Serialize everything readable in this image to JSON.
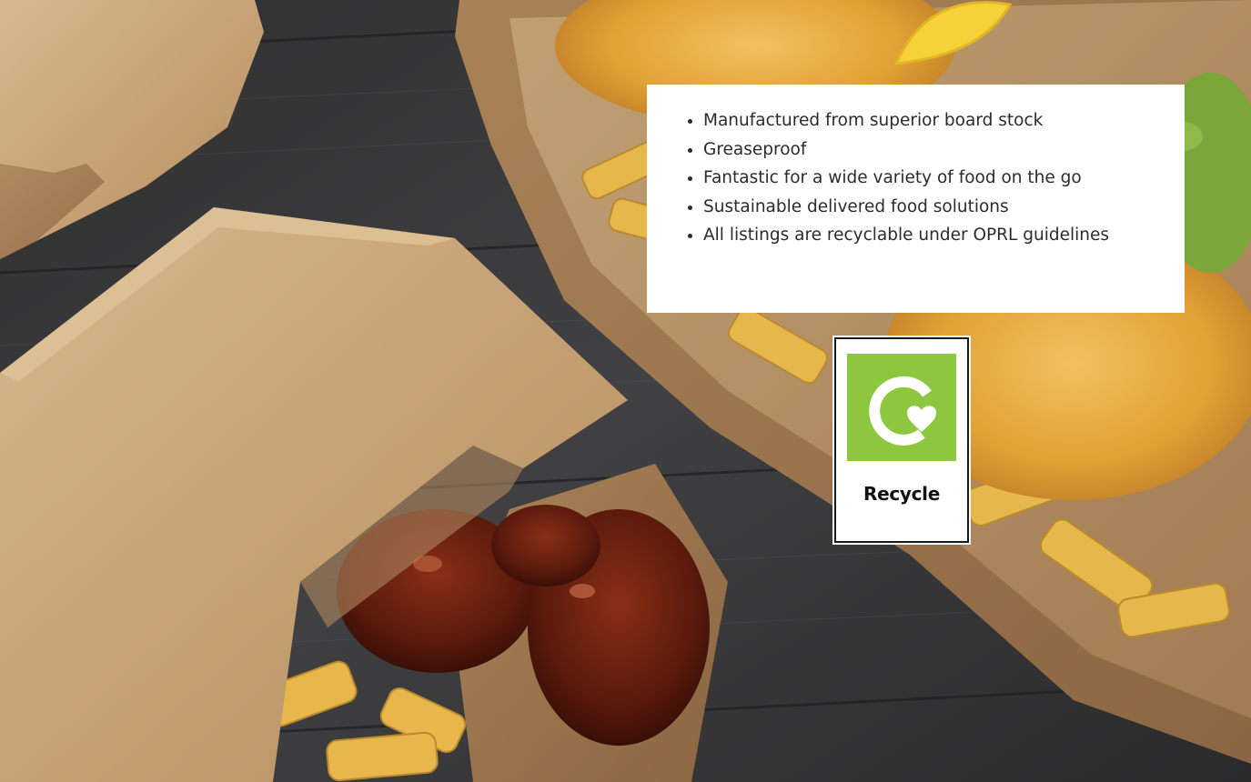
{
  "features": {
    "items": [
      "Manufactured from superior board stock",
      "Greaseproof",
      "Fantastic for a wide variety of food on the go",
      "Sustainable delivered food solutions",
      "All listings are recyclable under OPRL guidelines"
    ]
  },
  "recycle_badge": {
    "label": "Recycle",
    "icon": "recycle-icon",
    "accent": "#8dc63f"
  },
  "colors": {
    "table_wood": "#3a3a3a",
    "kraft_box": "#c9a57a",
    "batter": "#e5a93a",
    "lemon": "#f6d23a",
    "mushy_peas": "#7aa63a"
  }
}
